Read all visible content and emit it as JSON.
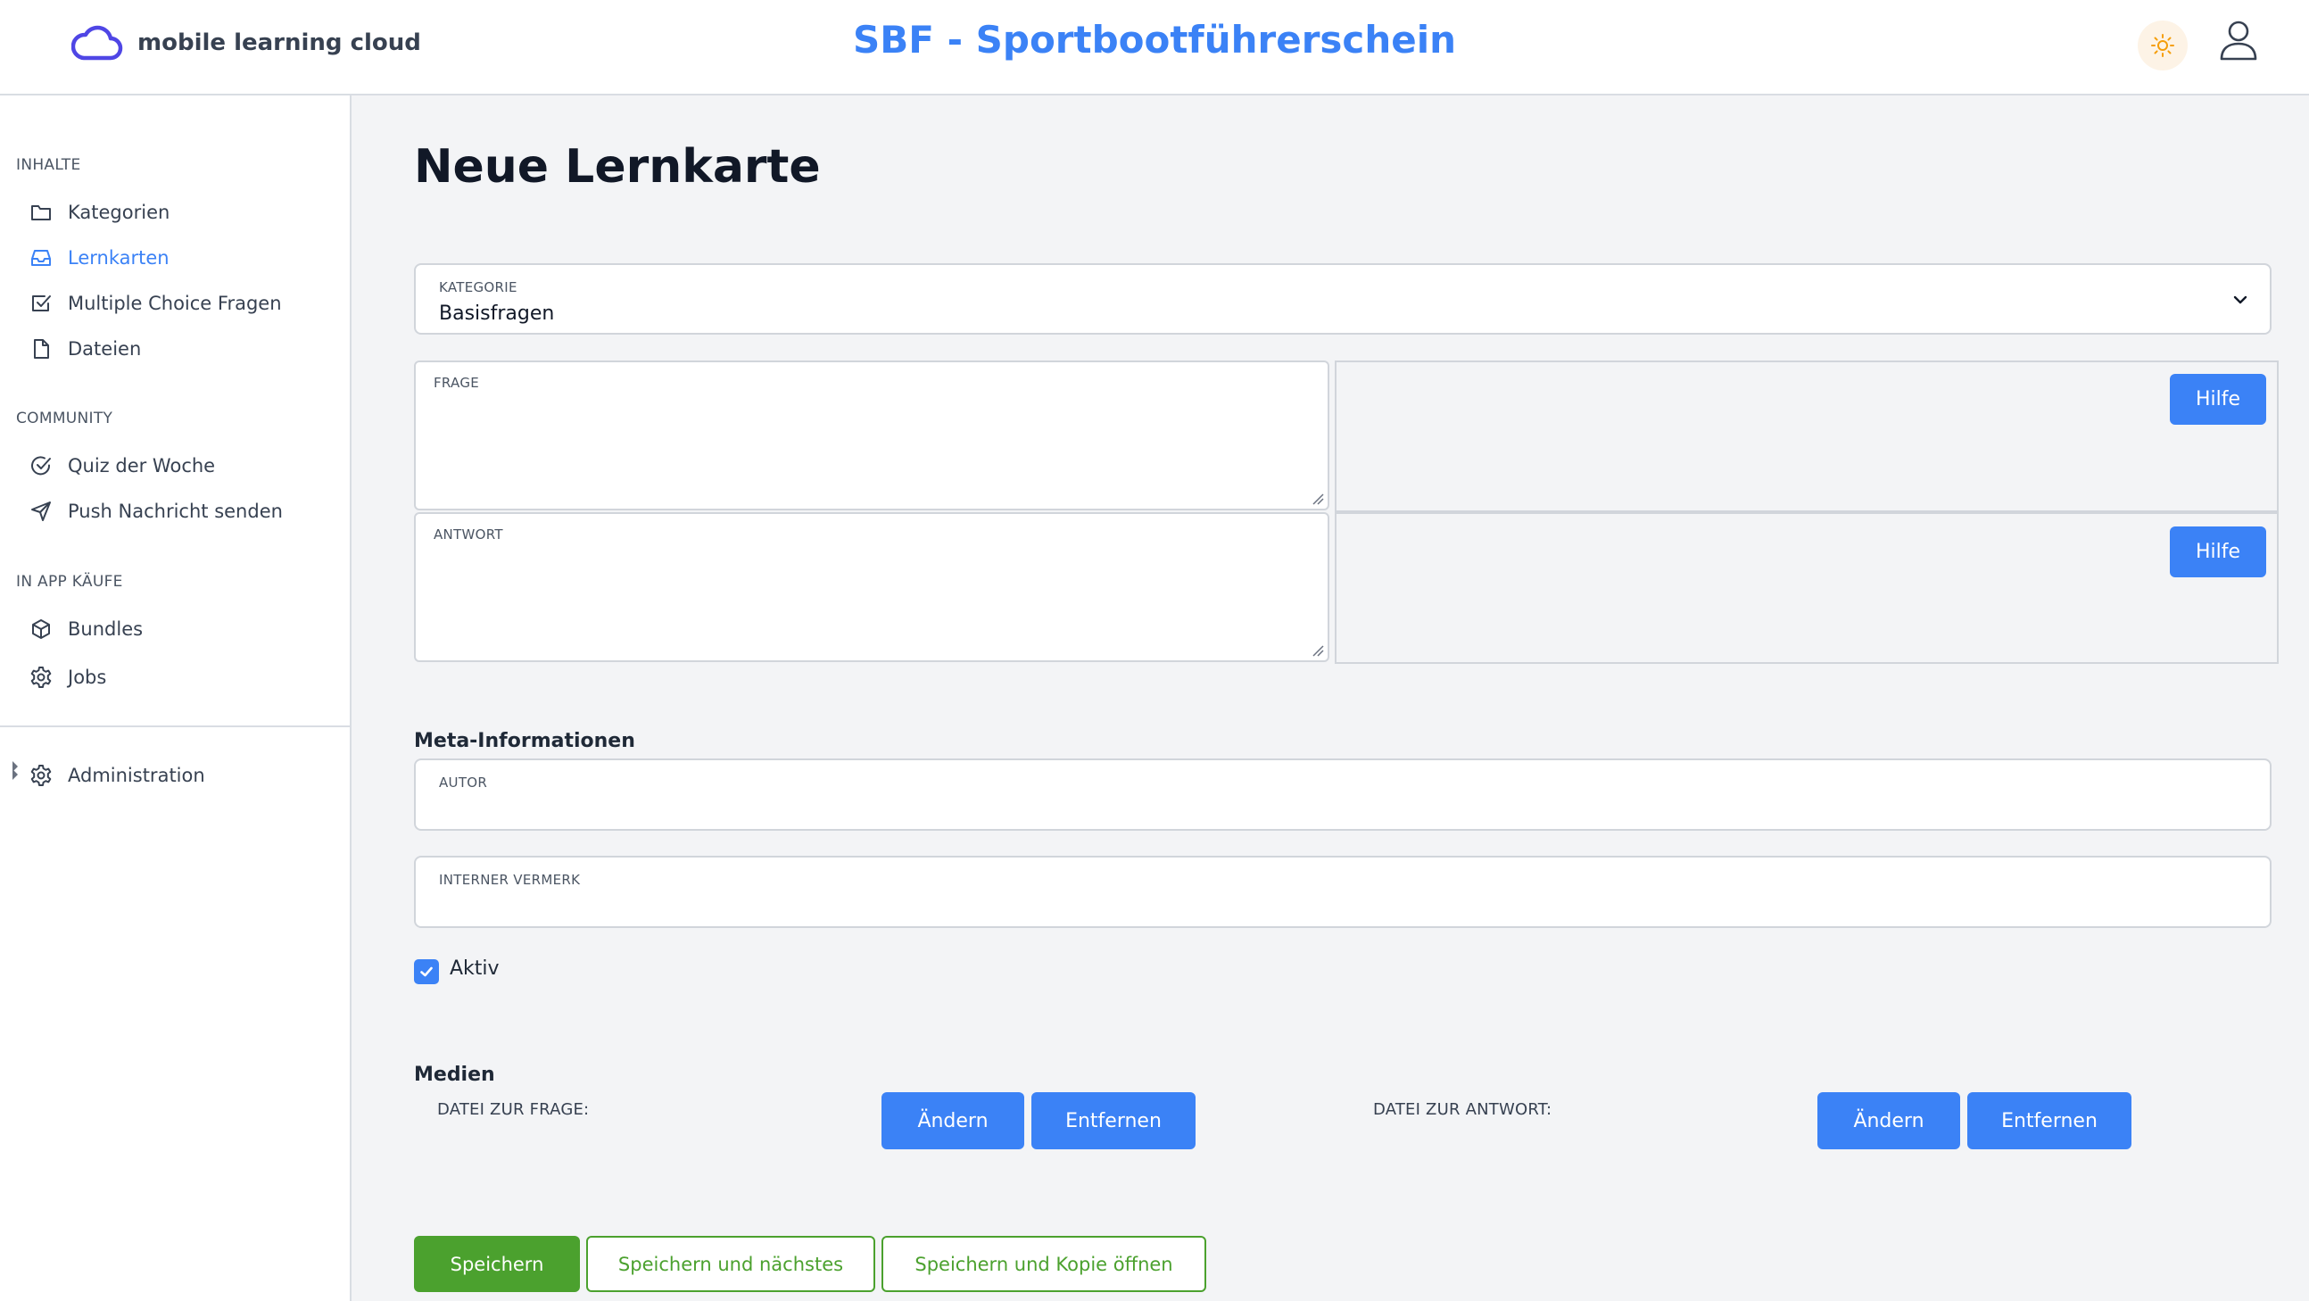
{
  "header": {
    "logo_text": "mobile learning cloud",
    "app_title": "SBF - Sportbootführerschein"
  },
  "sidebar": {
    "sections": [
      {
        "title": "INHALTE",
        "items": [
          "Kategorien",
          "Lernkarten",
          "Multiple Choice Fragen",
          "Dateien"
        ]
      },
      {
        "title": "COMMUNITY",
        "items": [
          "Quiz der Woche",
          "Push Nachricht senden"
        ]
      },
      {
        "title": "IN APP KÄUFE",
        "items": [
          "Bundles",
          "Jobs"
        ]
      }
    ],
    "admin_label": "Administration",
    "active_item": "Lernkarten"
  },
  "main": {
    "page_title": "Neue Lernkarte",
    "kategorie": {
      "label": "KATEGORIE",
      "value": "Basisfragen"
    },
    "frage": {
      "label": "FRAGE",
      "value": ""
    },
    "antwort": {
      "label": "ANTWORT",
      "value": ""
    },
    "help_button": "Hilfe",
    "meta_heading": "Meta-Informationen",
    "autor": {
      "label": "AUTOR",
      "value": ""
    },
    "vermerk": {
      "label": "INTERNER VERMERK",
      "value": ""
    },
    "aktiv": {
      "label": "Aktiv",
      "checked": true
    },
    "media_heading": "Medien",
    "media_frage_label": "DATEI ZUR FRAGE:",
    "media_antwort_label": "DATEI ZUR ANTWORT:",
    "change_button": "Ändern",
    "remove_button": "Entfernen",
    "save_button": "Speichern",
    "save_next_button": "Speichern und nächstes",
    "save_copy_button": "Speichern und Kopie öffnen"
  },
  "colors": {
    "accent": "#3b82f6",
    "success": "#4ba12e",
    "background": "#f3f4f6"
  }
}
